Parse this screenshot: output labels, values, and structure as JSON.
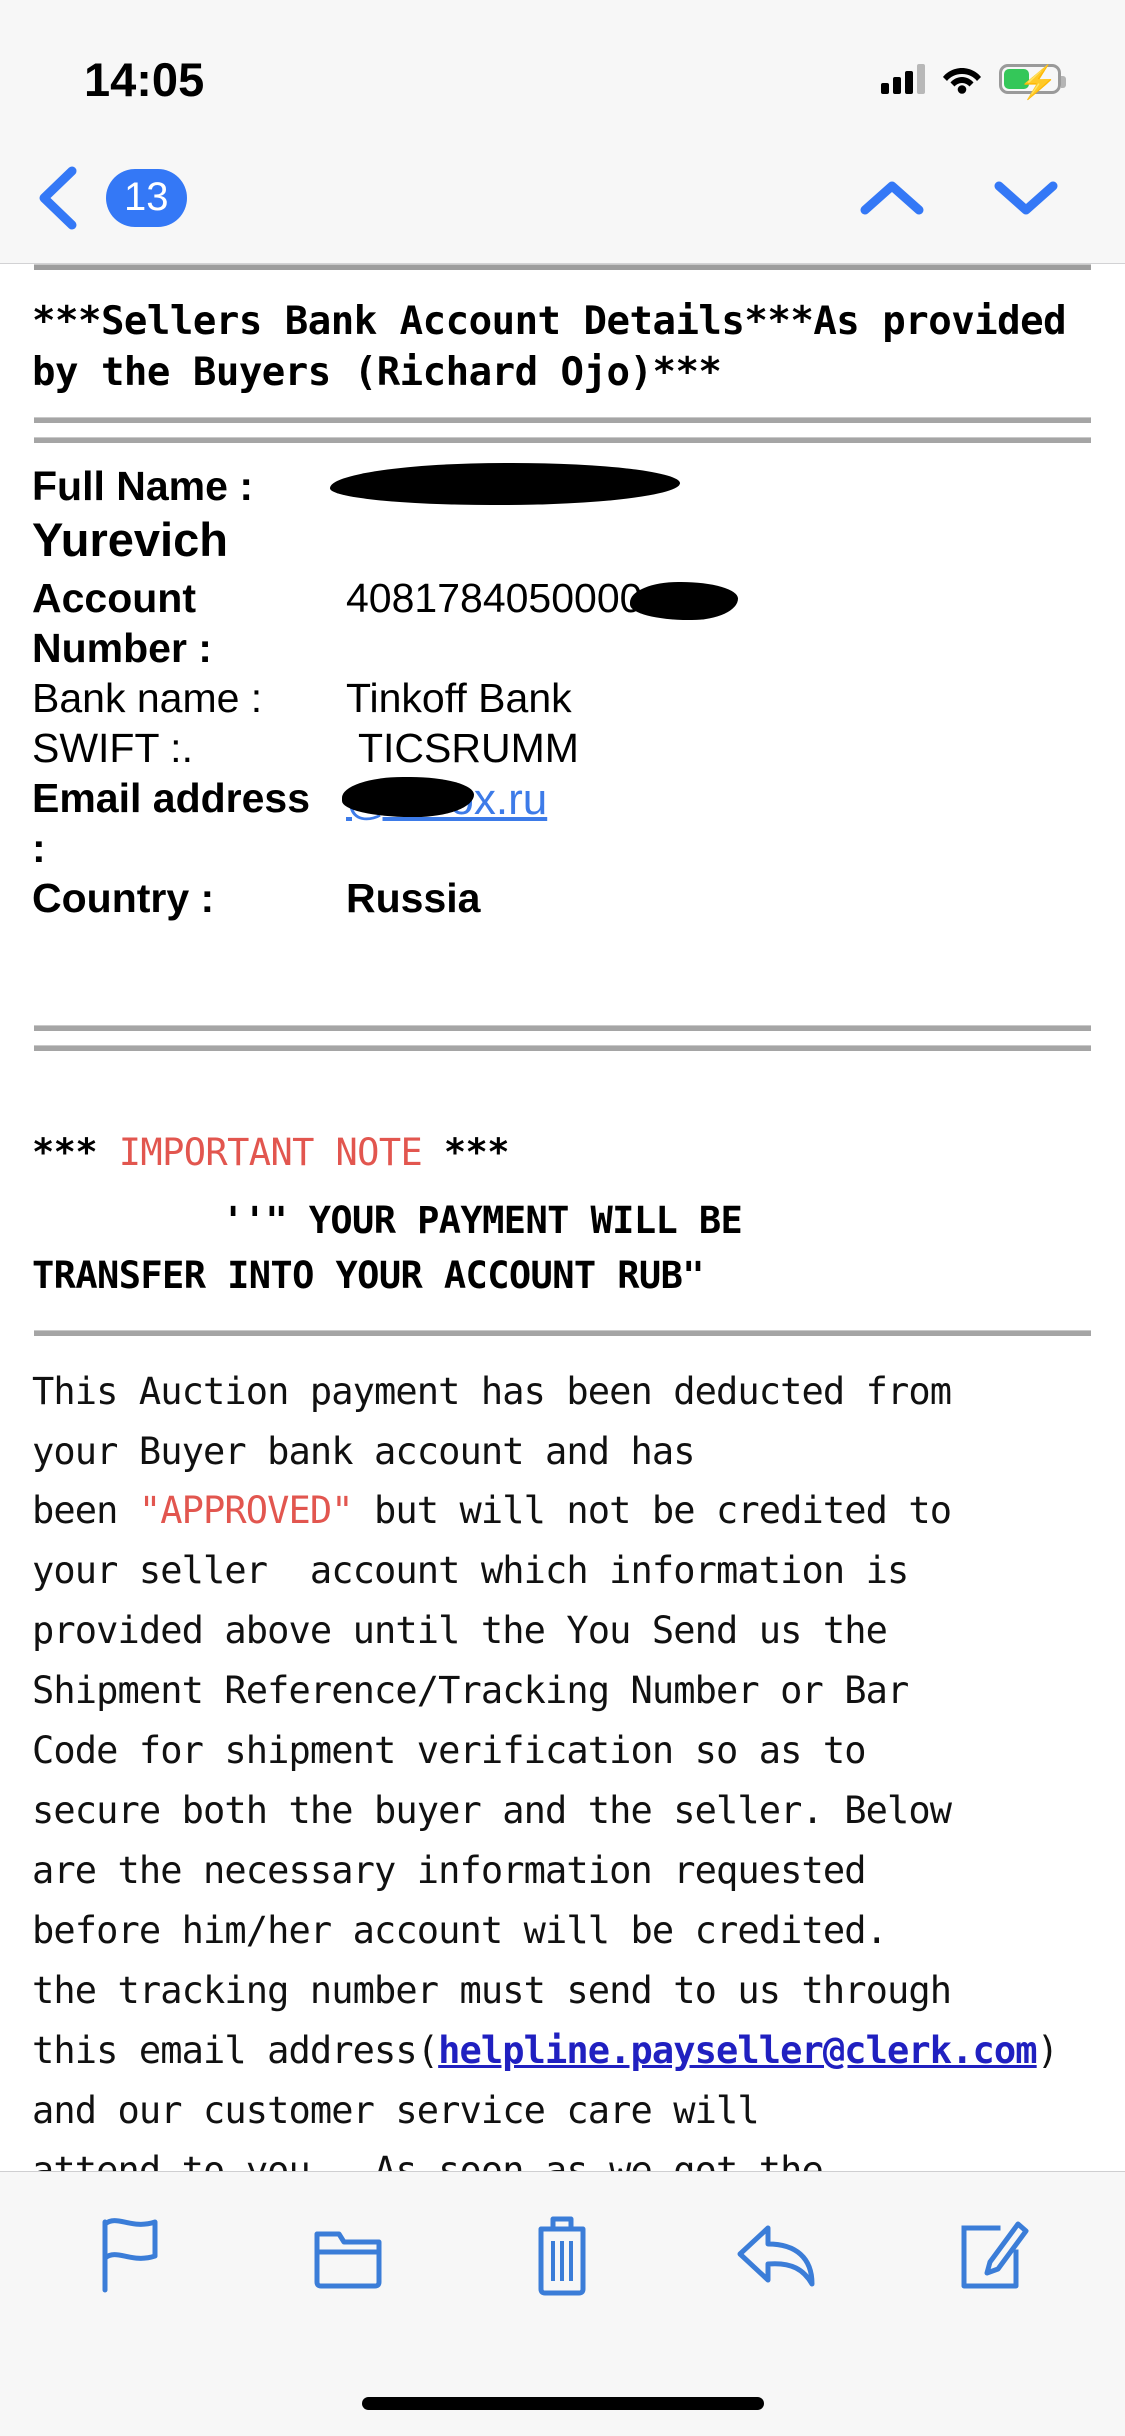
{
  "status_bar": {
    "time": "14:05",
    "cellular_icon": "cellular-signal-icon",
    "wifi_icon": "wifi-icon",
    "battery_icon": "battery-charging-icon",
    "battery_color": "#34c759"
  },
  "nav_bar": {
    "back_icon": "chevron-left-icon",
    "unread_badge": "13",
    "badge_color": "#3478f6",
    "prev_message_icon": "chevron-up-icon",
    "next_message_icon": "chevron-down-icon"
  },
  "email": {
    "heading": "***Sellers Bank Account Details***As provided by the Buyers  (Richard Ojo)***",
    "details": [
      {
        "label": "Full Name :",
        "value": "",
        "redacted": true,
        "bold_label": true
      },
      {
        "label": "",
        "value": "Yurevich",
        "redacted": false,
        "bold_label": false
      },
      {
        "label": "Account Number :",
        "value": "4081784050000",
        "redacted": true,
        "bold_label": true
      },
      {
        "label": "Bank name :",
        "value": "Tinkoff Bank",
        "redacted": false,
        "bold_label": false
      },
      {
        "label": "SWIFT :.",
        "value": "TICSRUMM",
        "redacted": false,
        "bold_label": false
      },
      {
        "label": "Email address  :",
        "value": "@inbox.ru",
        "redacted": true,
        "bold_label": true
      },
      {
        "label": "Country  :",
        "value": "Russia",
        "redacted": false,
        "bold_label": true
      }
    ],
    "full_name_label": "Full Name :",
    "full_name_second_line": "Yurevich",
    "account_number_label": "Account Number :",
    "account_number_value": "4081784050000",
    "bank_name_label": "Bank name :",
    "bank_name_value": "Tinkoff Bank",
    "swift_label": "SWIFT :.",
    "swift_value": "TICSRUMM",
    "email_label": "Email address  :",
    "email_value": "@inbox.ru",
    "country_label": "Country  :",
    "country_value": "Russia",
    "note_stars_left": "*** ",
    "note_title": "IMPORTANT NOTE",
    "note_stars_right": " ***",
    "note_color": "#e2564f",
    "note_line_1": "''\" YOUR PAYMENT WILL BE",
    "note_line_2": "TRANSFER INTO YOUR  ACCOUNT RUB\"",
    "body_part_1": "This Auction payment has been deducted from\nyour Buyer bank account and has\nbeen ",
    "body_approved": "\"APPROVED\"",
    "body_part_2": " but will not be credited to\nyour seller  account which information is\nprovided above until the You Send us the\nShipment Reference/Tracking Number or Bar\nCode for shipment verification so as to\nsecure both the buyer and the seller. Below\nare the necessary information requested\nbefore him/her account will be credited.\nthe tracking number must send to us through\nthis email address(",
    "body_link": "helpline.payseller@clerk.com",
    "body_part_3": ") and our customer service care will\nattend to you.. As soon as we got the\nshipment's tracking number for security\npurposes and the safety of the buyer with",
    "link_color": "#2020c0"
  },
  "toolbar": {
    "flag_label": "flag-icon",
    "folder_label": "folder-icon",
    "trash_label": "trash-icon",
    "reply_label": "reply-icon",
    "compose_label": "compose-icon",
    "accent_color": "#3b7dd8"
  }
}
